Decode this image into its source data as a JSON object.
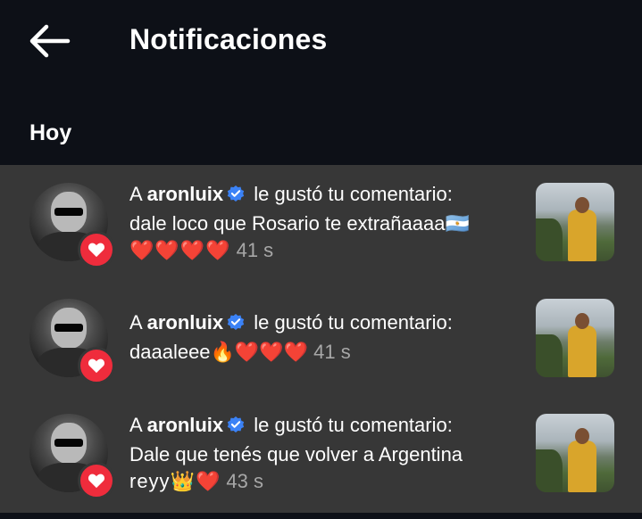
{
  "header": {
    "title": "Notificaciones",
    "back_icon": "arrow-left-icon"
  },
  "section": {
    "label": "Hoy"
  },
  "notifications": [
    {
      "prefix": "A ",
      "username": "aronluix",
      "action": " le gustó tu comentario:",
      "comment": "dale loco que Rosario te extrañaaaa🇦🇷",
      "emojis": "❤️❤️❤️❤️",
      "time": "41 s"
    },
    {
      "prefix": "A ",
      "username": "aronluix",
      "action": " le gustó tu comentario:",
      "comment": "daaaleee🔥❤️❤️❤️",
      "emojis": "",
      "time": "41 s"
    },
    {
      "prefix": "A ",
      "username": "aronluix",
      "action": " le gustó tu comentario:",
      "comment": "Dale que tenés que volver a Argentina",
      "emojis": "reyy👑❤️",
      "time": "43 s"
    }
  ],
  "colors": {
    "background": "#0d1017",
    "list_background": "#373737",
    "like_badge": "#ef2c3c",
    "verified": "#3b82f6",
    "time_text": "#a7a7a7"
  }
}
